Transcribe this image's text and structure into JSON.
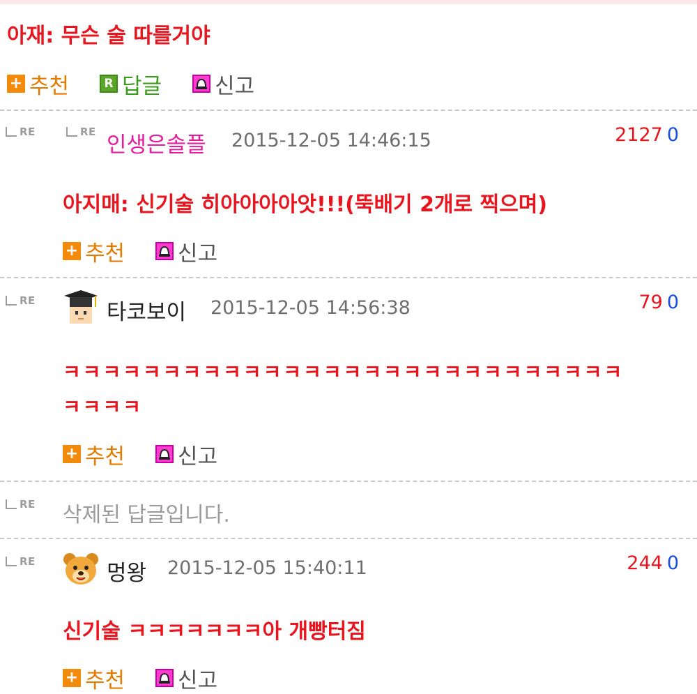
{
  "top_post": {
    "text": "아재: 무슨 술 따를거야",
    "actions": {
      "recommend": "추천",
      "reply": "답글",
      "report": "신고"
    }
  },
  "comments": [
    {
      "re": "RE",
      "nick": "인생은솔플",
      "timestamp": "2015-12-05 14:46:15",
      "count1": "2127",
      "count2": "0",
      "text": "아지매: 신기술 히아아아아앗!!!(뚝배기 2개로 찍으며)",
      "actions": {
        "recommend": "추천",
        "report": "신고"
      },
      "nick_color": "#e61ca0"
    },
    {
      "re": "RE",
      "nick": "타코보이",
      "timestamp": "2015-12-05 14:56:38",
      "count1": "79",
      "count2": "0",
      "text_line1": "ㅋㅋㅋㅋㅋㅋㅋㅋㅋㅋㅋㅋㅋㅋㅋㅋㅋㅋㅋㅋㅋㅋㅋㅋㅋㅋㅋㅋ",
      "text_line2": "ㅋㅋㅋㅋ",
      "actions": {
        "recommend": "추천",
        "report": "신고"
      },
      "avatar_icon": "graduate-boy-avatar-icon"
    },
    {
      "re": "RE",
      "deleted_text": "삭제된 답글입니다."
    },
    {
      "re": "RE",
      "nick": "멍왕",
      "timestamp": "2015-12-05 15:40:11",
      "count1": "244",
      "count2": "0",
      "text": "신기술 ㅋㅋㅋㅋㅋㅋㅋ아 개빵터짐",
      "actions": {
        "recommend": "추천",
        "report": "신고"
      },
      "avatar_icon": "dog-avatar-icon"
    }
  ],
  "colors": {
    "accent_red": "#e8141e",
    "count_blue": "#1a4de0",
    "recommend_orange": "#e37b00",
    "reply_green": "#3c9a1e"
  }
}
